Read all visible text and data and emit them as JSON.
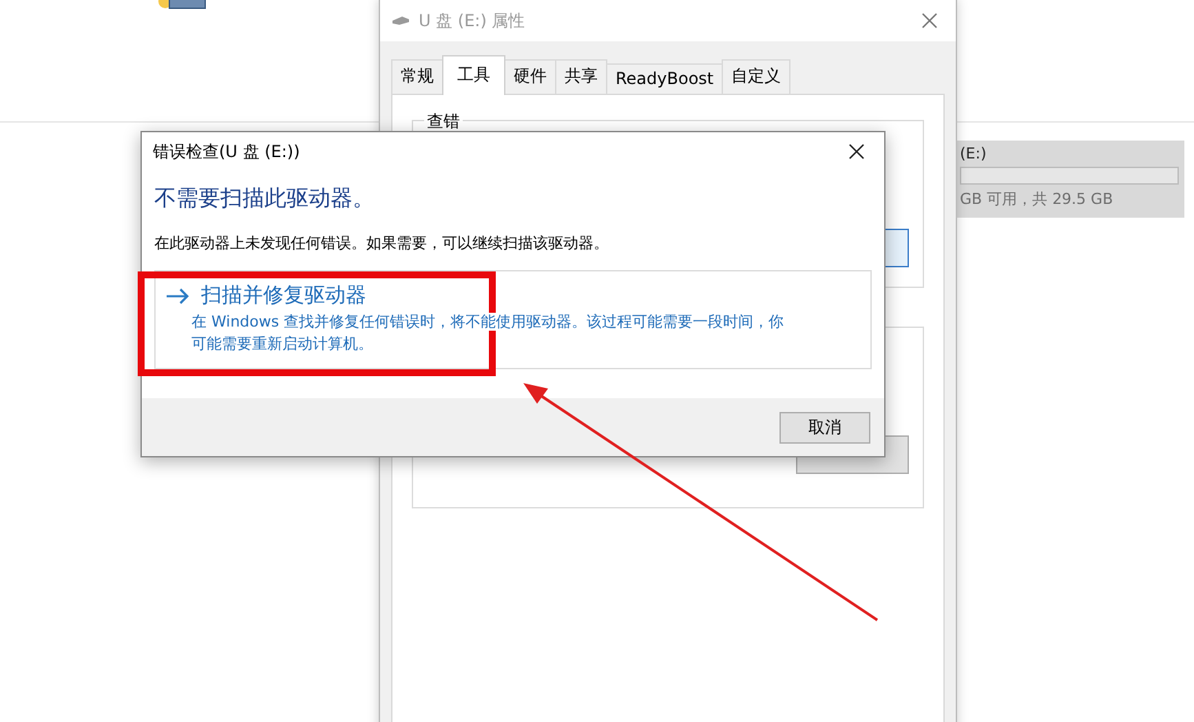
{
  "explorer": {
    "drive_tile": {
      "label": "(E:)",
      "capacity": "GB 可用，共 29.5 GB"
    }
  },
  "properties_window": {
    "title": "U 盘 (E:) 属性",
    "tabs": [
      {
        "label": "常规",
        "selected": false
      },
      {
        "label": "工具",
        "selected": true
      },
      {
        "label": "硬件",
        "selected": false
      },
      {
        "label": "共享",
        "selected": false
      },
      {
        "label": "ReadyBoost",
        "selected": false
      },
      {
        "label": "自定义",
        "selected": false
      }
    ],
    "groups": [
      {
        "title": "查错"
      }
    ]
  },
  "dialog": {
    "title": "错误检查(U 盘 (E:))",
    "heading": "不需要扫描此驱动器。",
    "message": "在此驱动器上未发现任何错误。如果需要，可以继续扫描该驱动器。",
    "option": {
      "title": "扫描并修复驱动器",
      "description": "在 Windows 查找并修复任何错误时，将不能使用驱动器。该过程可能需要一段时间，你可能需要重新启动计算机。"
    },
    "buttons": [
      "取消"
    ]
  }
}
